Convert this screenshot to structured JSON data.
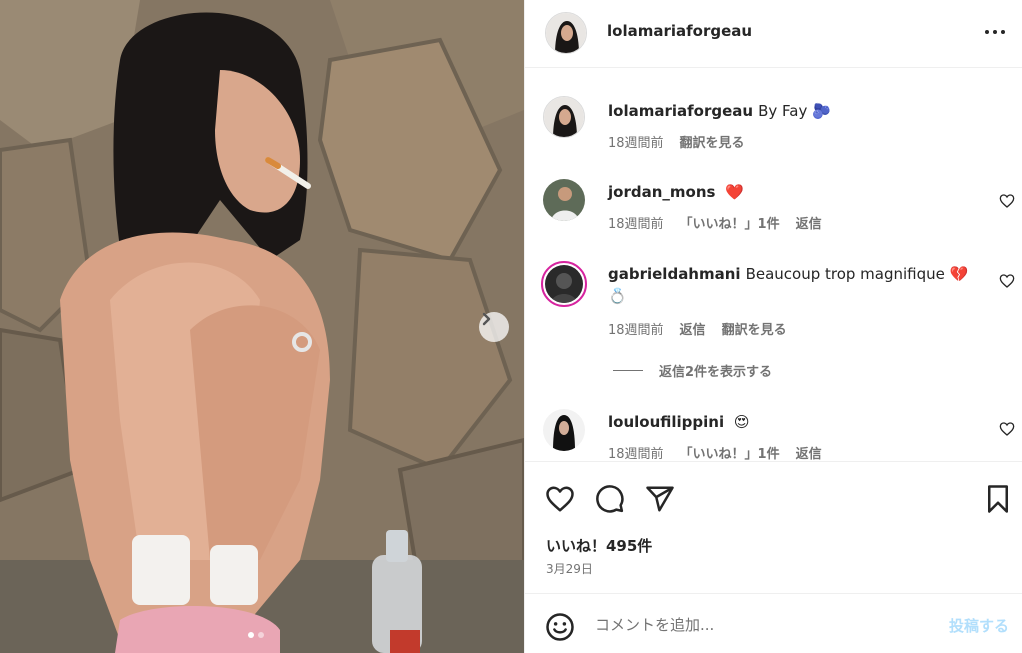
{
  "post": {
    "author": "lolamariaforgeau",
    "caption": {
      "username": "lolamariaforgeau",
      "text": "By Fay",
      "emoji": "🫐",
      "time": "18週間前",
      "translate": "翻訳を見る"
    },
    "comments": [
      {
        "username": "jordan_mons",
        "text": "❤️",
        "time": "18週間前",
        "likes": "「いいね！」1件",
        "reply": "返信"
      },
      {
        "username": "gabrieldahmani",
        "text": "Beaucoup trop magnifique 💔",
        "text2": "💍",
        "time": "18週間前",
        "reply": "返信",
        "translate": "翻訳を見る",
        "view_replies": "返信2件を表示する"
      },
      {
        "username": "louloufilippini",
        "text": "😍",
        "time": "18週間前",
        "likes": "「いいね！」1件",
        "reply": "返信"
      }
    ],
    "likes": "いいね！495件",
    "date": "3月29日",
    "comment_placeholder": "コメントを追加...",
    "post_button": "投稿する"
  },
  "carousel": {
    "current": 1,
    "total": 2
  },
  "icons": [
    "more-icon",
    "heart-icon",
    "comment-icon",
    "share-icon",
    "bookmark-icon",
    "emoji-icon",
    "chevron-right-icon"
  ],
  "colors": {
    "post_button": "#b2dffc",
    "heart": "#ff3040",
    "story_ring": "#d6249f",
    "secondary_text": "#737373"
  }
}
